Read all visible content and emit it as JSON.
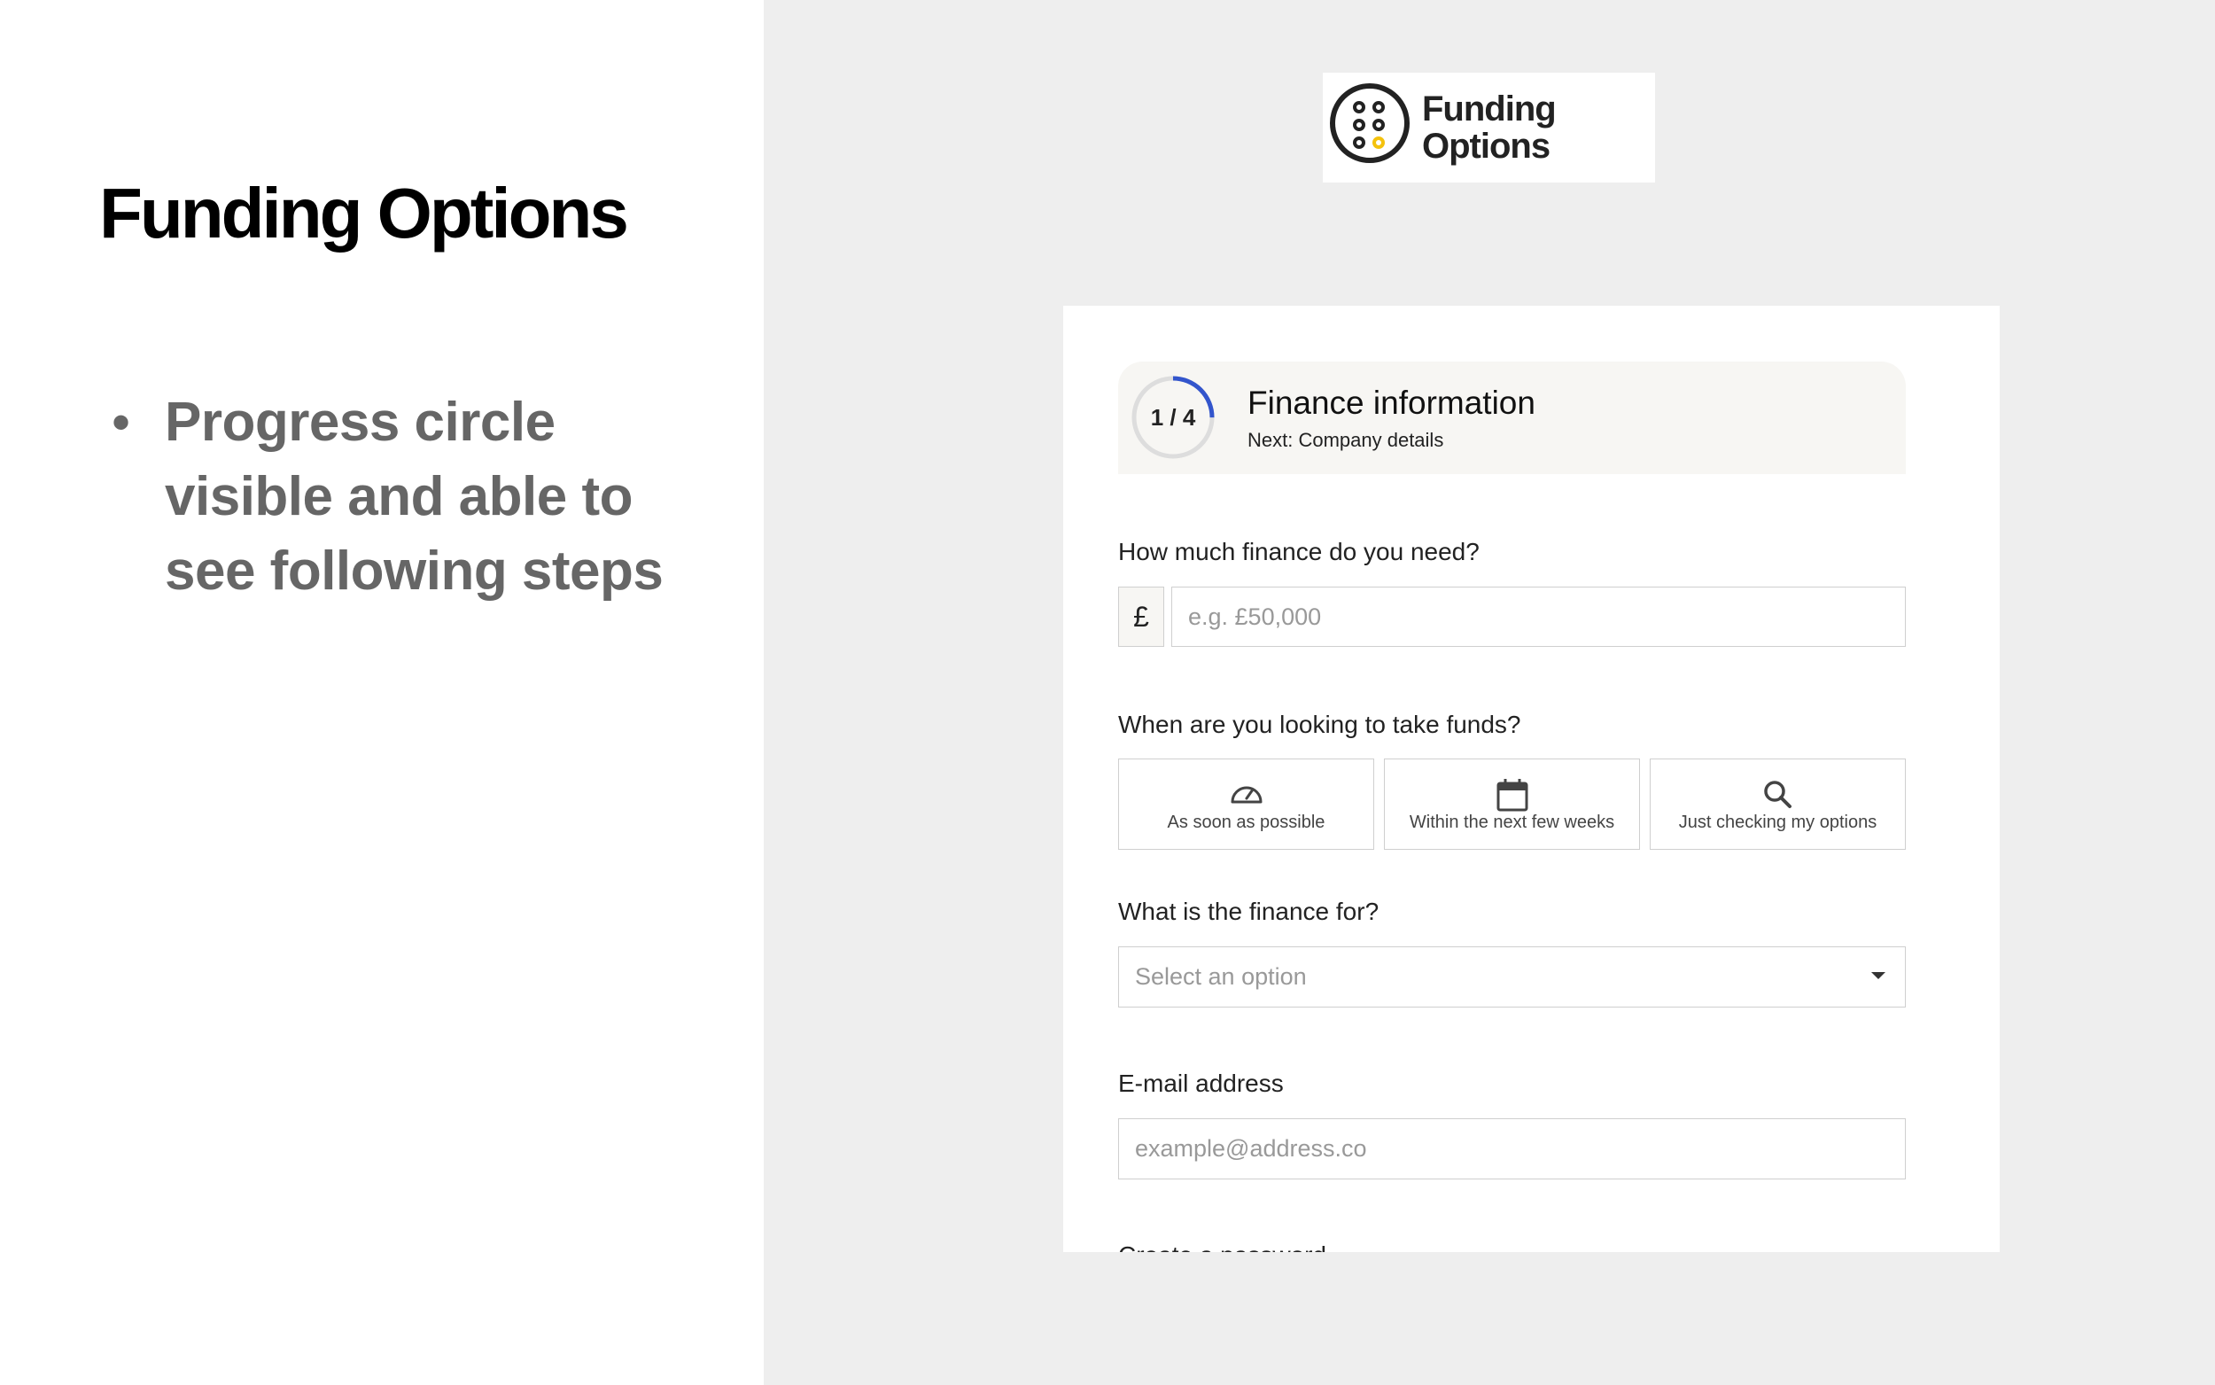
{
  "slide": {
    "title": "Funding Options",
    "bullets": [
      "Progress circle visible and able to see following steps"
    ]
  },
  "logo": {
    "line1": "Funding",
    "line2": "Options"
  },
  "progress": {
    "label": "1 / 4",
    "fraction": 0.25,
    "accent": "#3355cc",
    "title": "Finance information",
    "next": "Next: Company details"
  },
  "form": {
    "amount": {
      "label": "How much finance do you need?",
      "currency": "£",
      "placeholder": "e.g. £50,000"
    },
    "timing": {
      "label": "When are you looking to take funds?",
      "options": [
        {
          "icon": "speedometer-icon",
          "label": "As soon as possible"
        },
        {
          "icon": "calendar-icon",
          "label": "Within the next few weeks"
        },
        {
          "icon": "search-icon",
          "label": "Just checking my options"
        }
      ]
    },
    "purpose": {
      "label": "What is the finance for?",
      "placeholder": "Select an option"
    },
    "email": {
      "label": "E-mail address",
      "placeholder": "example@address.co"
    },
    "password": {
      "label": "Create a password"
    }
  }
}
